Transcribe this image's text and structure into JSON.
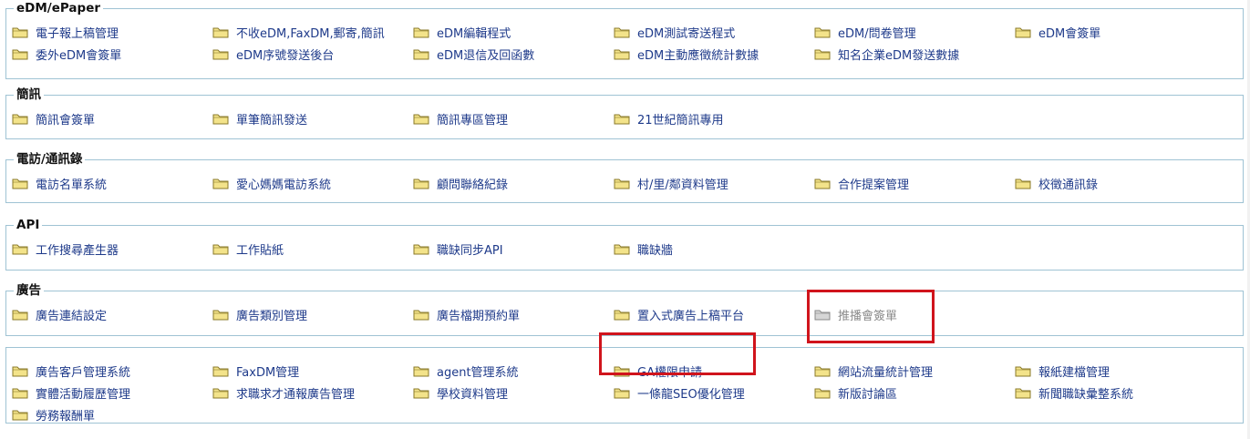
{
  "sections": [
    {
      "title": "eDM/ePaper",
      "items": [
        {
          "label": "電子報上稿管理"
        },
        {
          "label": "不收eDM,FaxDM,郵寄,簡訊"
        },
        {
          "label": "eDM編輯程式"
        },
        {
          "label": "eDM測試寄送程式"
        },
        {
          "label": "eDM/問卷管理"
        },
        {
          "label": "eDM會簽單"
        },
        {
          "label": "委外eDM會簽單"
        },
        {
          "label": "eDM序號發送後台"
        },
        {
          "label": "eDM退信及回函數"
        },
        {
          "label": "eDM主動應徵統計數據"
        },
        {
          "label": "知名企業eDM發送數據"
        }
      ]
    },
    {
      "title": "簡訊",
      "items": [
        {
          "label": "簡訊會簽單"
        },
        {
          "label": "單筆簡訊發送"
        },
        {
          "label": "簡訊專區管理"
        },
        {
          "label": "21世紀簡訊專用"
        }
      ]
    },
    {
      "title": "電訪/通訊錄",
      "items": [
        {
          "label": "電訪名單系統"
        },
        {
          "label": "愛心媽媽電訪系統"
        },
        {
          "label": "顧問聯絡紀錄"
        },
        {
          "label": "村/里/鄰資料管理"
        },
        {
          "label": "合作提案管理"
        },
        {
          "label": "校徵通訊錄"
        }
      ]
    },
    {
      "title": "API",
      "items": [
        {
          "label": "工作搜尋產生器"
        },
        {
          "label": "工作貼紙"
        },
        {
          "label": "職缺同步API"
        },
        {
          "label": "職缺牆"
        }
      ]
    },
    {
      "title": "廣告",
      "items": [
        {
          "label": "廣告連結設定"
        },
        {
          "label": "廣告類別管理"
        },
        {
          "label": "廣告檔期預約單"
        },
        {
          "label": "置入式廣告上稿平台"
        },
        {
          "label": "推播會簽單",
          "disabled": true
        }
      ]
    },
    {
      "title": "",
      "items": [
        {
          "label": "廣告客戶管理系統"
        },
        {
          "label": "FaxDM管理"
        },
        {
          "label": "agent管理系統"
        },
        {
          "label": "GA權限申請"
        },
        {
          "label": "網站流量統計管理"
        },
        {
          "label": "報紙建檔管理"
        },
        {
          "label": "實體活動履歷管理"
        },
        {
          "label": "求職求才通報廣告管理"
        },
        {
          "label": "學校資料管理"
        },
        {
          "label": "一條龍SEO優化管理"
        },
        {
          "label": "新版討論區"
        },
        {
          "label": "新聞職缺彙整系統"
        },
        {
          "label": "勞務報酬單"
        }
      ]
    }
  ],
  "colors": {
    "link": "#1e3a8a",
    "disabled": "#8a8a8a",
    "border": "#9fc3d4",
    "highlight": "#d0141c",
    "folder_fill": "#f3e38a",
    "folder_stroke": "#8a7a2a",
    "folder_disabled_fill": "#d6d6d6"
  },
  "icons": {
    "item": "folder-icon"
  }
}
